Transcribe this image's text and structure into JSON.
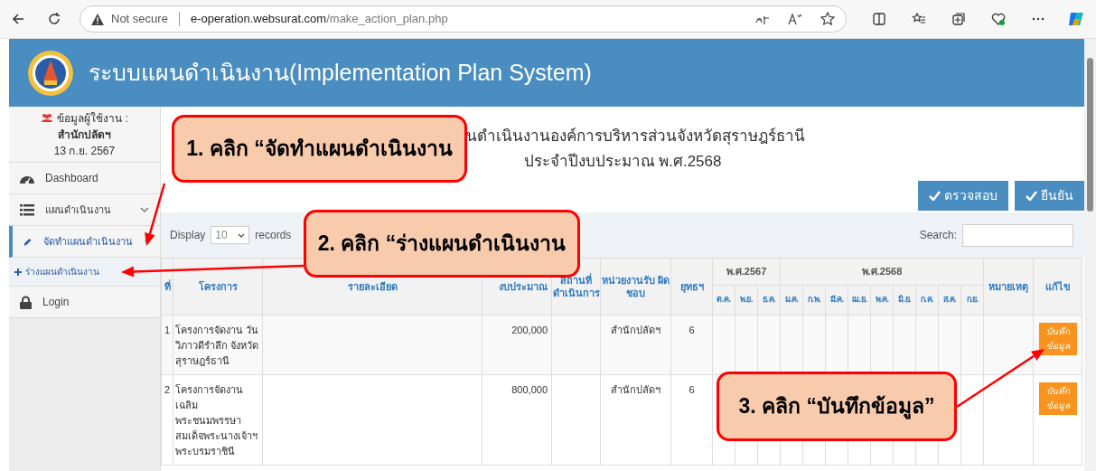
{
  "browser": {
    "security": "Not secure",
    "url_host": "e-operation.websurat.com",
    "url_path": "/make_action_plan.php"
  },
  "header": {
    "title": "ระบบแผนดำเนินงาน(Implementation Plan System)"
  },
  "sidebar": {
    "user_label": "ข้อมูลผู้ใช้งาน :",
    "user_name": "สำนักปลัดฯ",
    "date": "13 ก.ย. 2567",
    "items": [
      {
        "label": "Dashboard",
        "selected": false,
        "expandable": false
      },
      {
        "label": "แผนดำเนินงาน",
        "selected": false,
        "expandable": true
      },
      {
        "label": "จัดทำแผนดำเนินงาน",
        "selected": true,
        "expandable": true,
        "children": [
          {
            "label": "ร่างแผนดำเนินงาน"
          }
        ]
      },
      {
        "label": "Login",
        "selected": false,
        "expandable": false
      }
    ]
  },
  "page": {
    "title_line1": "นดำเนินงานองค์การบริหารส่วนจังหวัดสุราษฎร์ธานี",
    "title_line2": "ประจำปีงบประมาณ พ.ศ.2568",
    "buttons": [
      "ตรวจสอบ",
      "ยืนยัน"
    ]
  },
  "table": {
    "display_label": "Display",
    "page_size": "10",
    "records_label": "records",
    "search_label": "Search:",
    "columns": [
      "ที่",
      "โครงการ",
      "รายละเอียด",
      "งบประมาณ",
      "สถานที่ ดำเนินการ",
      "หน่วยงานรับ ผิดชอบ",
      "ยุทธฯ"
    ],
    "month_groups": [
      {
        "label": "พ.ศ.2567",
        "months": [
          "ต.ค.",
          "พ.ย.",
          "ธ.ค."
        ]
      },
      {
        "label": "พ.ศ.2568",
        "months": [
          "ม.ค.",
          "ก.พ.",
          "มี.ค.",
          "เม.ย.",
          "พ.ค.",
          "มิ.ย.",
          "ก.ค.",
          "ส.ค.",
          "ก.ย."
        ]
      }
    ],
    "end_columns": [
      "หมายเหตุ",
      "แก้ไข"
    ],
    "rows": [
      {
        "no": "1",
        "project": "โครงการจัดงาน วัน วิภาวดีรำลึก จังหวัด สุราษฎร์ธานี",
        "budget": "200,000",
        "unit": "สำนักปลัดฯ",
        "strategy": "6",
        "action": "บันทึก ข้อมูล"
      },
      {
        "no": "2",
        "project": "โครงการจัดงาน เฉลิม พระชนมพรรษา สมเด็จพระนางเจ้าฯ พระบรมราชินี",
        "budget": "800,000",
        "unit": "สำนักปลัดฯ",
        "strategy": "6",
        "action": "บันทึก ข้อมูล"
      }
    ]
  },
  "callouts": [
    {
      "text": "1. คลิก “จัดทำแผนดำเนินงาน"
    },
    {
      "text": "2. คลิก “ร่างแผนดำเนินงาน"
    },
    {
      "text": "3. คลิก “บันทึกข้อมูล”"
    }
  ]
}
